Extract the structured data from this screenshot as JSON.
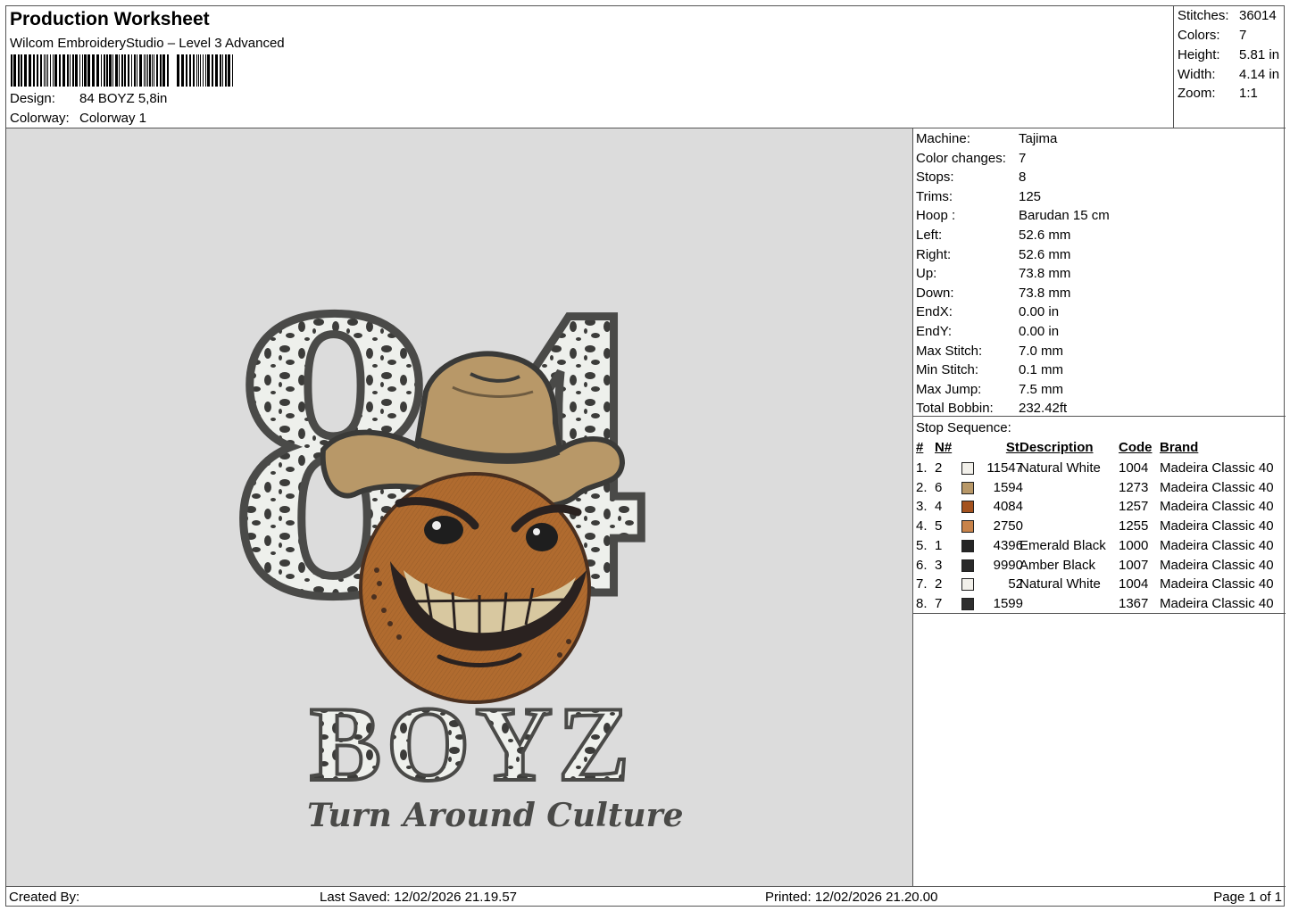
{
  "header": {
    "title": "Production Worksheet",
    "software": "Wilcom EmbroideryStudio – Level 3 Advanced",
    "design_label": "Design:",
    "design_value": "84 BOYZ 5,8in",
    "colorway_label": "Colorway:",
    "colorway_value": "Colorway 1"
  },
  "summary": {
    "stitches_label": "Stitches:",
    "stitches_value": "36014",
    "colors_label": "Colors:",
    "colors_value": "7",
    "height_label": "Height:",
    "height_value": "5.81 in",
    "width_label": "Width:",
    "width_value": "4.14 in",
    "zoom_label": "Zoom:",
    "zoom_value": "1:1"
  },
  "artwork": {
    "top_text": "84",
    "main_text": "BOYZ",
    "tagline": "Turn Around Culture"
  },
  "info": [
    {
      "k": "Machine:",
      "v": "Tajima"
    },
    {
      "k": "Color changes:",
      "v": "7"
    },
    {
      "k": "Stops:",
      "v": "8"
    },
    {
      "k": "Trims:",
      "v": "125"
    },
    {
      "k": "Hoop :",
      "v": "Barudan 15 cm"
    },
    {
      "k": "Left:",
      "v": "52.6 mm"
    },
    {
      "k": "Right:",
      "v": "52.6 mm"
    },
    {
      "k": "Up:",
      "v": "73.8 mm"
    },
    {
      "k": "Down:",
      "v": "73.8 mm"
    },
    {
      "k": "EndX:",
      "v": "0.00 in"
    },
    {
      "k": "EndY:",
      "v": "0.00 in"
    },
    {
      "k": "Max Stitch:",
      "v": "7.0 mm"
    },
    {
      "k": "Min Stitch:",
      "v": "0.1 mm"
    },
    {
      "k": "Max Jump:",
      "v": "7.5 mm"
    },
    {
      "k": "Total Bobbin:",
      "v": "232.42ft"
    }
  ],
  "stops": {
    "title": "Stop Sequence:",
    "headers": {
      "idx": "#",
      "n": "N#",
      "st": "St.",
      "desc": "Description",
      "code": "Code",
      "brand": "Brand"
    },
    "rows": [
      {
        "idx": "1.",
        "n": "2",
        "color": "#f2f0ea",
        "st": "11547",
        "desc": "Natural White",
        "code": "1004",
        "brand": "Madeira Classic 40"
      },
      {
        "idx": "2.",
        "n": "6",
        "color": "#b89868",
        "st": "1594",
        "desc": "",
        "code": "1273",
        "brand": "Madeira Classic 40"
      },
      {
        "idx": "3.",
        "n": "4",
        "color": "#a4521e",
        "st": "4084",
        "desc": "",
        "code": "1257",
        "brand": "Madeira Classic 40"
      },
      {
        "idx": "4.",
        "n": "5",
        "color": "#c8834a",
        "st": "2750",
        "desc": "",
        "code": "1255",
        "brand": "Madeira Classic 40"
      },
      {
        "idx": "5.",
        "n": "1",
        "color": "#262626",
        "st": "4396",
        "desc": "Emerald Black",
        "code": "1000",
        "brand": "Madeira Classic 40"
      },
      {
        "idx": "6.",
        "n": "3",
        "color": "#2a2a2a",
        "st": "9990",
        "desc": "Amber Black",
        "code": "1007",
        "brand": "Madeira Classic 40"
      },
      {
        "idx": "7.",
        "n": "2",
        "color": "#f2f0ea",
        "st": "52",
        "desc": "Natural White",
        "code": "1004",
        "brand": "Madeira Classic 40"
      },
      {
        "idx": "8.",
        "n": "7",
        "color": "#2e2e2e",
        "st": "1599",
        "desc": "",
        "code": "1367",
        "brand": "Madeira Classic 40"
      }
    ]
  },
  "footer": {
    "created_by": "Created By:",
    "last_saved": "Last Saved: 12/02/2026 21.19.57",
    "printed": "Printed: 12/02/2026 21.20.00",
    "page": "Page 1 of 1"
  }
}
